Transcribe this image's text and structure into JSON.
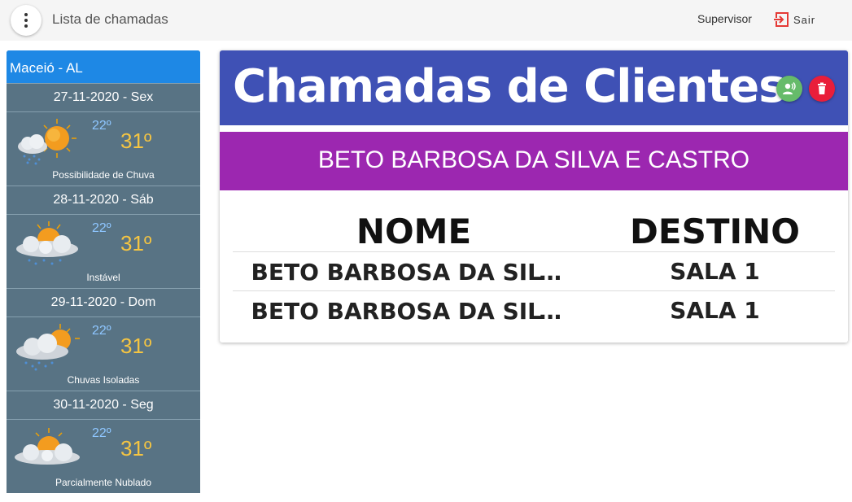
{
  "topbar": {
    "title": "Lista de chamadas",
    "user": "Supervisor",
    "logout_label": "Sair"
  },
  "weather": {
    "city": "Maceió - AL",
    "days": [
      {
        "date": "27-11-2020 - Sex",
        "min": "22º",
        "max": "31º",
        "desc": "Possibilidade de Chuva",
        "icon": "sun-rain-cloud-icon"
      },
      {
        "date": "28-11-2020 - Sáb",
        "min": "22º",
        "max": "31º",
        "desc": "Instável",
        "icon": "sun-cloud-rain-icon"
      },
      {
        "date": "29-11-2020 - Dom",
        "min": "22º",
        "max": "31º",
        "desc": "Chuvas Isoladas",
        "icon": "sun-cloud-rain-icon"
      },
      {
        "date": "30-11-2020 - Seg",
        "min": "22º",
        "max": "31º",
        "desc": "Parcialmente Nublado",
        "icon": "sun-cloud-icon"
      }
    ]
  },
  "card": {
    "title": "Chamadas de Clientes",
    "client_name": "BETO BARBOSA DA SILVA E CASTRO",
    "columns": [
      "NOME",
      "DESTINO"
    ],
    "rows": [
      {
        "nome": "BETO BARBOSA DA SILVA E CASTRO",
        "destino": "SALA 1"
      },
      {
        "nome": "BETO BARBOSA DA SILVA E CASTRO",
        "destino": "SALA 1"
      }
    ]
  },
  "colors": {
    "topbar_bg": "#f5f5f5",
    "sidebar_bg": "#587384",
    "city_bg": "#1e88e5",
    "card_header": "#3f51b5",
    "client_banner": "#9c27b0",
    "call_button": "#66bb6a",
    "delete_button": "#e91e3a",
    "logout_icon": "#e53935"
  }
}
